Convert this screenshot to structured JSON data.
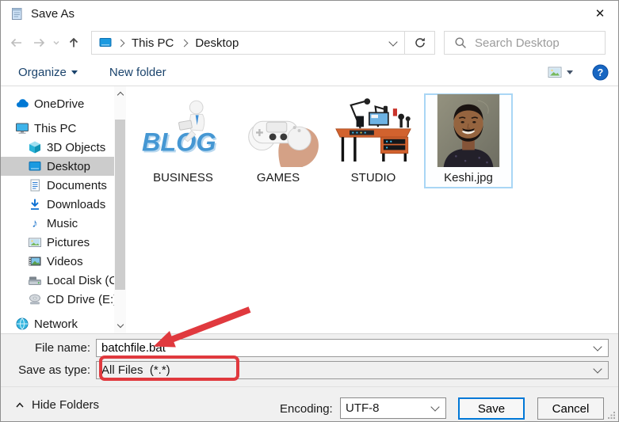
{
  "window": {
    "title": "Save As"
  },
  "icons": {
    "close_x": "✕",
    "music_note": "♪"
  },
  "navbar": {
    "breadcrumb_root": "This PC",
    "breadcrumb_current": "Desktop",
    "search_placeholder": "Search Desktop"
  },
  "toolbar": {
    "organize_label": "Organize",
    "new_folder_label": "New folder"
  },
  "sidebar": {
    "items": [
      {
        "label": "OneDrive",
        "icon": "onedrive-cloud-icon"
      },
      {
        "label": "This PC",
        "icon": "computer-monitor-icon"
      },
      {
        "label": "3D Objects",
        "icon": "3d-cube-icon"
      },
      {
        "label": "Desktop",
        "icon": "desktop-monitor-icon"
      },
      {
        "label": "Documents",
        "icon": "document-icon"
      },
      {
        "label": "Downloads",
        "icon": "download-arrow-icon"
      },
      {
        "label": "Music",
        "icon": "music-note-icon"
      },
      {
        "label": "Pictures",
        "icon": "picture-icon"
      },
      {
        "label": "Videos",
        "icon": "film-frame-icon"
      },
      {
        "label": "Local Disk (C",
        "icon": "hard-disk-icon"
      },
      {
        "label": "CD Drive (E:)",
        "icon": "cd-disc-icon"
      },
      {
        "label": "Network",
        "icon": "network-globe-icon"
      }
    ]
  },
  "files": [
    {
      "label": "BUSINESS",
      "icon": "blog-figure-thumbnail",
      "selected": false
    },
    {
      "label": "GAMES",
      "icon": "game-controller-thumbnail",
      "selected": false
    },
    {
      "label": "STUDIO",
      "icon": "studio-desk-thumbnail",
      "selected": false
    },
    {
      "label": "Keshi.jpg",
      "icon": "portrait-photo-thumbnail",
      "selected": true
    }
  ],
  "form": {
    "file_name_label": "File name:",
    "file_name_value": "batchfile.bat",
    "save_as_type_label": "Save as type:",
    "save_as_type_value": "All Files  (*.*)",
    "hide_folders_label": "Hide Folders",
    "encoding_label": "Encoding:",
    "encoding_value": "UTF-8",
    "save_label": "Save",
    "cancel_label": "Cancel"
  },
  "colors": {
    "accent_blue": "#0078d7",
    "annotation_red": "#e0393e",
    "selection_border": "#a9d6f5",
    "sidebar_selected_bg": "#cccccc"
  }
}
